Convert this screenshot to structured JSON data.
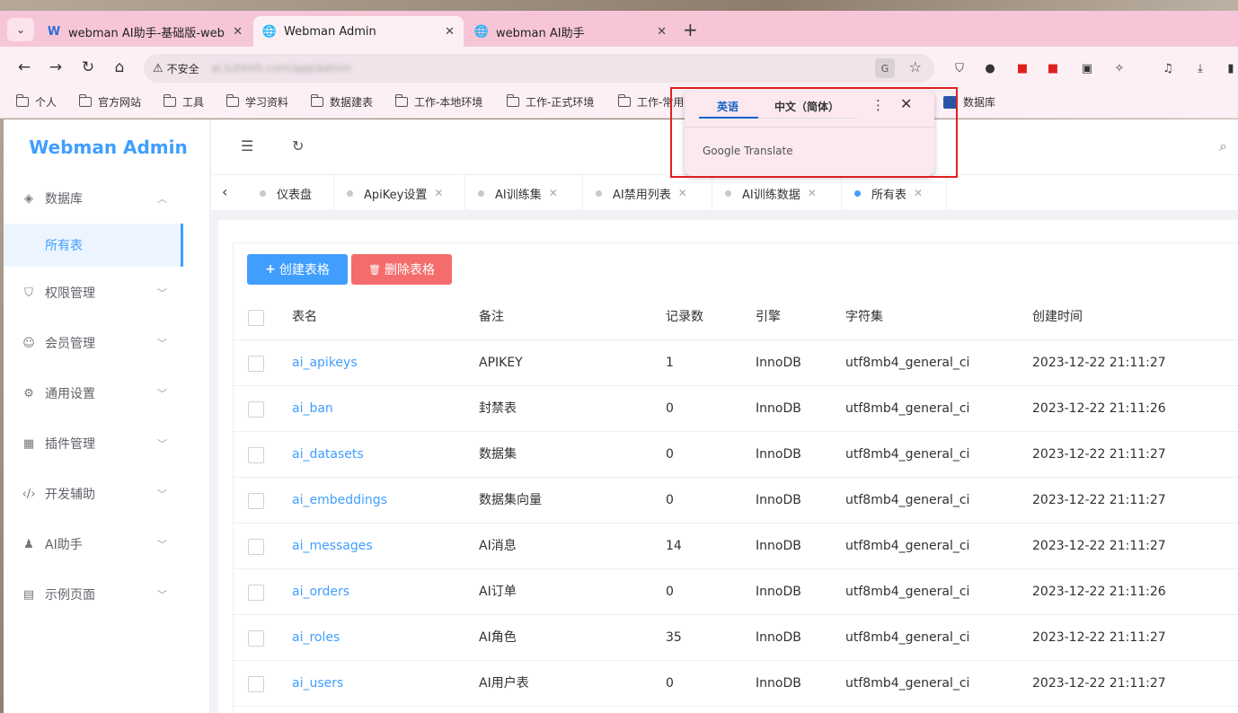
{
  "browser": {
    "tabs": [
      {
        "title": "webman AI助手-基础版-webm",
        "fav": "W",
        "active": false
      },
      {
        "title": "Webman Admin",
        "fav": "🌐",
        "active": true
      },
      {
        "title": "webman AI助手",
        "fav": "🌐",
        "active": false
      }
    ],
    "new_tab": "+",
    "close": "✕",
    "insecure_label": "不安全",
    "url": "ai.tuhhhh.com/app/admin",
    "bookmarks": [
      "个人",
      "官方网站",
      "工具",
      "学习资料",
      "数据建表",
      "工作-本地环境",
      "工作-正式环境",
      "工作-常用",
      "数据库"
    ]
  },
  "translate_popup": {
    "lang_source": "英语",
    "lang_target": "中文（简体）",
    "brand": "Google Translate"
  },
  "app": {
    "logo": "Webman Admin",
    "menu": [
      {
        "label": "数据库",
        "icon": "layers-icon"
      },
      {
        "label": "权限管理",
        "icon": "shield-icon"
      },
      {
        "label": "会员管理",
        "icon": "user-icon"
      },
      {
        "label": "通用设置",
        "icon": "gear-icon"
      },
      {
        "label": "插件管理",
        "icon": "grid-icon"
      },
      {
        "label": "开发辅助",
        "icon": "code-icon"
      },
      {
        "label": "AI助手",
        "icon": "android-icon"
      },
      {
        "label": "示例页面",
        "icon": "image-icon"
      }
    ],
    "submenu_active": "所有表",
    "page_tabs": [
      {
        "label": "仪表盘",
        "active": false,
        "closable": false
      },
      {
        "label": "ApiKey设置",
        "active": false,
        "closable": true
      },
      {
        "label": "AI训练集",
        "active": false,
        "closable": true
      },
      {
        "label": "AI禁用列表",
        "active": false,
        "closable": true
      },
      {
        "label": "AI训练数据",
        "active": false,
        "closable": true
      },
      {
        "label": "所有表",
        "active": true,
        "closable": true
      }
    ],
    "buttons": {
      "create": "创建表格",
      "delete": "删除表格"
    },
    "table": {
      "headers": [
        "表名",
        "备注",
        "记录数",
        "引擎",
        "字符集",
        "创建时间"
      ],
      "rows": [
        [
          "ai_apikeys",
          "APIKEY",
          "1",
          "InnoDB",
          "utf8mb4_general_ci",
          "2023-12-22 21:11:27"
        ],
        [
          "ai_ban",
          "封禁表",
          "0",
          "InnoDB",
          "utf8mb4_general_ci",
          "2023-12-22 21:11:26"
        ],
        [
          "ai_datasets",
          "数据集",
          "0",
          "InnoDB",
          "utf8mb4_general_ci",
          "2023-12-22 21:11:27"
        ],
        [
          "ai_embeddings",
          "数据集向量",
          "0",
          "InnoDB",
          "utf8mb4_general_ci",
          "2023-12-22 21:11:27"
        ],
        [
          "ai_messages",
          "AI消息",
          "14",
          "InnoDB",
          "utf8mb4_general_ci",
          "2023-12-22 21:11:27"
        ],
        [
          "ai_orders",
          "AI订单",
          "0",
          "InnoDB",
          "utf8mb4_general_ci",
          "2023-12-22 21:11:26"
        ],
        [
          "ai_roles",
          "AI角色",
          "35",
          "InnoDB",
          "utf8mb4_general_ci",
          "2023-12-22 21:11:27"
        ],
        [
          "ai_users",
          "AI用户表",
          "0",
          "InnoDB",
          "utf8mb4_general_ci",
          "2023-12-22 21:11:27"
        ]
      ]
    }
  },
  "colors": {
    "accent": "#409eff",
    "danger": "#f56c6c",
    "highlight_box": "#e02020"
  }
}
